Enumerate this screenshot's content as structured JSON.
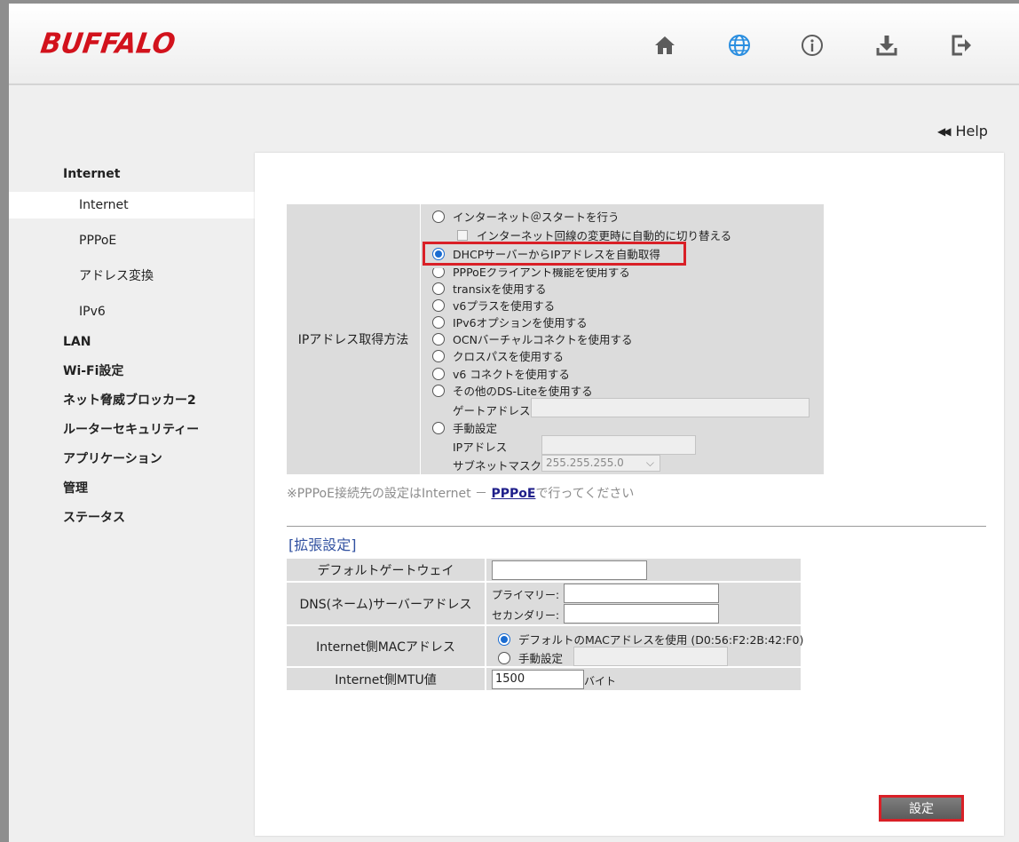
{
  "header": {
    "logo": "BUFFALO",
    "icons": [
      "home-icon",
      "globe-icon",
      "info-icon",
      "download-icon",
      "logout-icon"
    ],
    "help": "Help"
  },
  "sidebar": {
    "groups": [
      {
        "label": "Internet",
        "sub": [
          {
            "label": "Internet",
            "active": true
          },
          {
            "label": "PPPoE"
          },
          {
            "label": "アドレス変換"
          },
          {
            "label": "IPv6"
          }
        ]
      },
      {
        "label": "LAN"
      },
      {
        "label": "Wi-Fi設定"
      },
      {
        "label": "ネット脅威ブロッカー2"
      },
      {
        "label": "ルーターセキュリティー"
      },
      {
        "label": "アプリケーション"
      },
      {
        "label": "管理"
      },
      {
        "label": "ステータス"
      }
    ]
  },
  "ip": {
    "label": "IPアドレス取得方法",
    "options": [
      "インターネット＠スタートを行う",
      "インターネット回線の変更時に自動的に切り替える",
      "DHCPサーバーからIPアドレスを自動取得",
      "PPPoEクライアント機能を使用する",
      "transixを使用する",
      "v6プラスを使用する",
      "IPv6オプションを使用する",
      "OCNバーチャルコネクトを使用する",
      "クロスパスを使用する",
      "v6 コネクトを使用する",
      "その他のDS-Liteを使用する",
      "手動設定"
    ],
    "gateway_label": "ゲートアドレス",
    "ipaddr_label": "IPアドレス",
    "subnet_label": "サブネットマスク",
    "subnet_value": "255.255.255.0"
  },
  "note": {
    "prefix": "※PPPoE接続先の設定はInternet － ",
    "link": "PPPoE",
    "suffix": "で行ってください"
  },
  "ext": {
    "title": "[拡張設定]",
    "gateway_label": "デフォルトゲートウェイ",
    "dns_label": "DNS(ネーム)サーバーアドレス",
    "primary": "プライマリー:",
    "secondary": "セカンダリー:",
    "mac_label": "Internet側MACアドレス",
    "mac_default": "デフォルトのMACアドレスを使用 (D0:56:F2:2B:42:F0)",
    "mac_manual": "手動設定",
    "mtu_label": "Internet側MTU値",
    "mtu_value": "1500",
    "mtu_unit": "バイト"
  },
  "submit": "設定",
  "colors": {
    "brand": "#d2121c",
    "highlight": "#d92027",
    "radio": "#1a6cd1",
    "globe": "#2a8ee0"
  }
}
